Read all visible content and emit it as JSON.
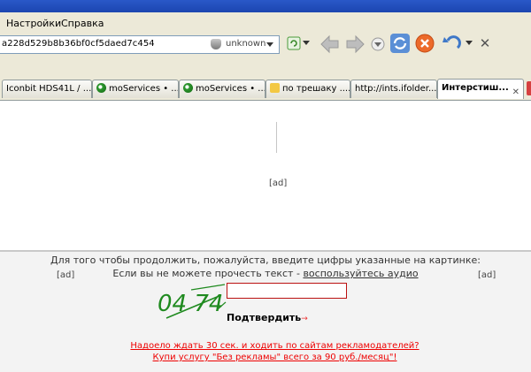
{
  "menu": {
    "items": [
      "Настройки",
      "Справка"
    ]
  },
  "address": {
    "url_text": "a228d529b8b36bf0cf5daed7c454",
    "security_status": "unknown"
  },
  "tabs": [
    {
      "label": "Iconbit HDS41L / ...",
      "icon": "none"
    },
    {
      "label": "moServices • ...",
      "icon": "green-globe-icon"
    },
    {
      "label": "moServices • ...",
      "icon": "green-globe-icon"
    },
    {
      "label": "по трешаку ....",
      "icon": "yellow-page-icon"
    },
    {
      "label": "http://ints.ifolder....",
      "icon": "none"
    },
    {
      "label": "Интерстиш...",
      "icon": "none",
      "active": true
    }
  ],
  "page": {
    "ad_top": "[ad]",
    "ad_left": "[ad]",
    "ad_right": "[ad]",
    "instruction_line1": "Для того чтобы продолжить, пожалуйста, введите цифры указанные на картинке:",
    "instruction_line2_prefix": "Если вы не можете прочесть текст -",
    "audio_link": "воспользуйтесь аудио",
    "captcha_text": "04 74",
    "captcha_input_value": "",
    "submit_label": "Подтвердить",
    "promo_line1": "Надоело ждать 30 сек. и ходить по сайтам рекламодателей?",
    "promo_line2": "Купи услугу \"Без рекламы\" всего за 90 руб./месяц\"!"
  },
  "colors": {
    "chrome": "#ece9d8",
    "link_red": "#e00000",
    "captcha_green": "#1f8a1f",
    "input_border": "#b11111"
  }
}
